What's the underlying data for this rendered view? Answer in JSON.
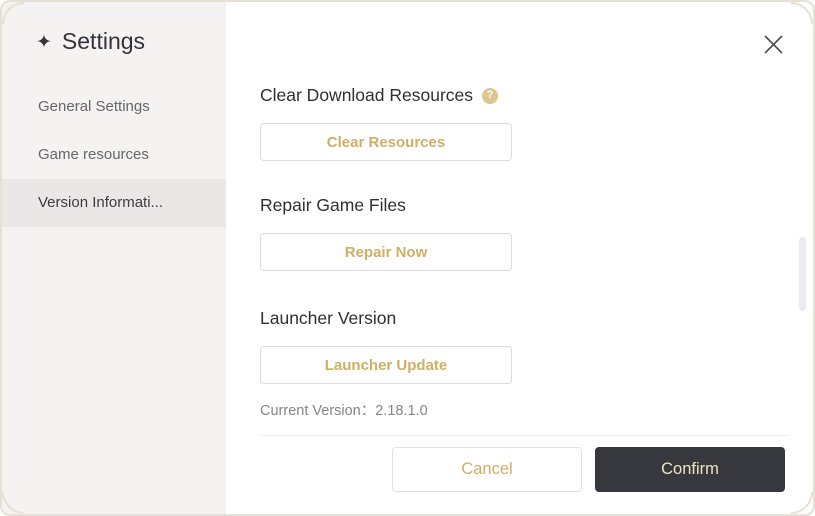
{
  "window": {
    "title": "Settings"
  },
  "icons": {
    "title_star": "✦",
    "help": "?"
  },
  "sidebar": {
    "items": [
      {
        "label": "General Settings",
        "selected": false
      },
      {
        "label": "Game resources",
        "selected": false
      },
      {
        "label": "Version Informati...",
        "selected": true
      }
    ]
  },
  "main": {
    "sections": [
      {
        "heading": "Clear Download Resources",
        "button_label": "Clear Resources"
      },
      {
        "heading": "Repair Game Files",
        "button_label": "Repair Now"
      },
      {
        "heading": "Launcher Version",
        "button_label": "Launcher Update",
        "note": "Current Version：2.18.1.0"
      }
    ],
    "footer": {
      "cancel_label": "Cancel",
      "confirm_label": "Confirm"
    }
  },
  "colors": {
    "accent_gold": "#d0ae65",
    "confirm_bg": "#36383e",
    "confirm_text": "#f1e3c1",
    "sidebar_bg": "#f4f3f1",
    "sidebar_selected_bg": "#e9e8e6",
    "heading_text": "#2f2f38",
    "muted_text": "#85858b",
    "frame_border": "#e6e1d5",
    "help_icon_bg": "#dac68f"
  }
}
